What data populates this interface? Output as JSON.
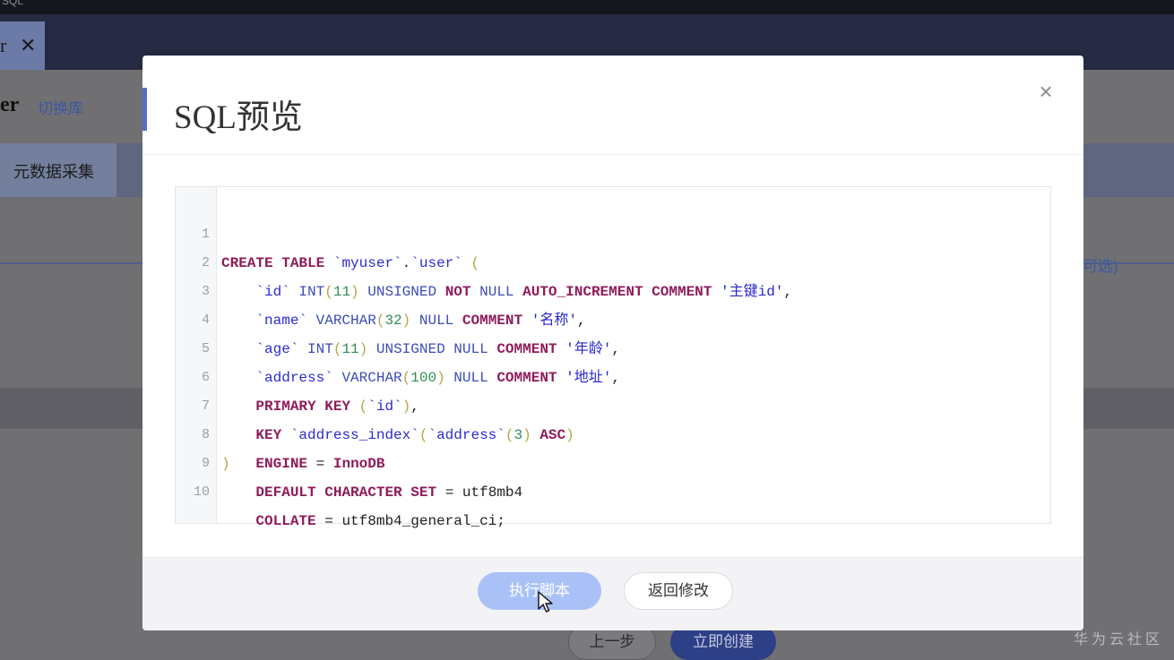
{
  "background": {
    "window_title": "SQL",
    "tab_label": "r",
    "tab_close": "✕",
    "page_title": "er",
    "switch_db_link": "切换库",
    "subtab_label": "元数据采集",
    "optional_hint": "可选)",
    "prev_button": "上一步",
    "create_button": "立即创建"
  },
  "modal": {
    "title": "SQL预览",
    "close": "×",
    "code": {
      "line_numbers": [
        "1",
        "2",
        "3",
        "4",
        "5",
        "6",
        "7",
        "8",
        "9",
        "10"
      ]
    },
    "footer": {
      "execute_button": "执行脚本",
      "back_button": "返回修改"
    }
  },
  "watermark": "华为云社区"
}
